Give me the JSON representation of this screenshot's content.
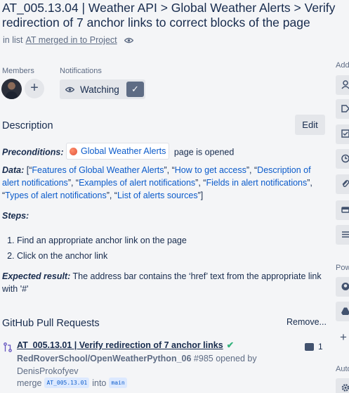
{
  "card": {
    "title_line1": "AT_005.13.04 | Weather API > Global Weather Alerts > Verify",
    "title_line2": "redirection of 7 anchor links to correct blocks of the page",
    "in_list_prefix": "in list",
    "list_name": "AT merged in to Project"
  },
  "members": {
    "label": "Members",
    "add_label": "+"
  },
  "notifications": {
    "label": "Notifications",
    "watch_label": "Watching"
  },
  "description": {
    "heading": "Description",
    "edit_label": "Edit",
    "preconditions_label": "Preconditions:",
    "preconditions_chip": "Global Weather Alerts",
    "preconditions_suffix": "page is opened",
    "data_label": "Data:",
    "data_open": "[",
    "data_items": [
      "Features of Global Weather Alerts",
      "How to get access",
      "Description of alert notifications",
      "Examples of alert notifications",
      "Fields in alert notifications",
      "Types of alert notifications",
      "List of alerts sources"
    ],
    "data_close": "]",
    "steps_label": "Steps:",
    "steps": [
      "Find an appropriate anchor link on the page",
      "Click on the anchor link"
    ],
    "expected_label": "Expected result:",
    "expected_text": "The address bar contains the ‘href’ text from the appropriate link with '#'"
  },
  "github": {
    "heading": "GitHub Pull Requests",
    "remove_label": "Remove...",
    "pr": {
      "title": "AT_005.13.01 | Verify redirection of 7 anchor links",
      "check": "✔",
      "comment_count": "1",
      "repo": "RedRoverSchool/OpenWeatherPython_06",
      "number_text": "#985 opened by",
      "author": "DenisProkofyev",
      "merge_word": "merge",
      "from_branch": "AT_005.13.01",
      "into_word": "into",
      "to_branch": "main"
    }
  },
  "sidebar": {
    "add_label": "Add",
    "power_label": "Pow",
    "auto_label": "Auto"
  },
  "colors": {
    "link": "#0b5bcb",
    "text": "#172b4d",
    "muted": "#5e6c84",
    "button": "#e4e6ea",
    "success": "#36b37e"
  }
}
